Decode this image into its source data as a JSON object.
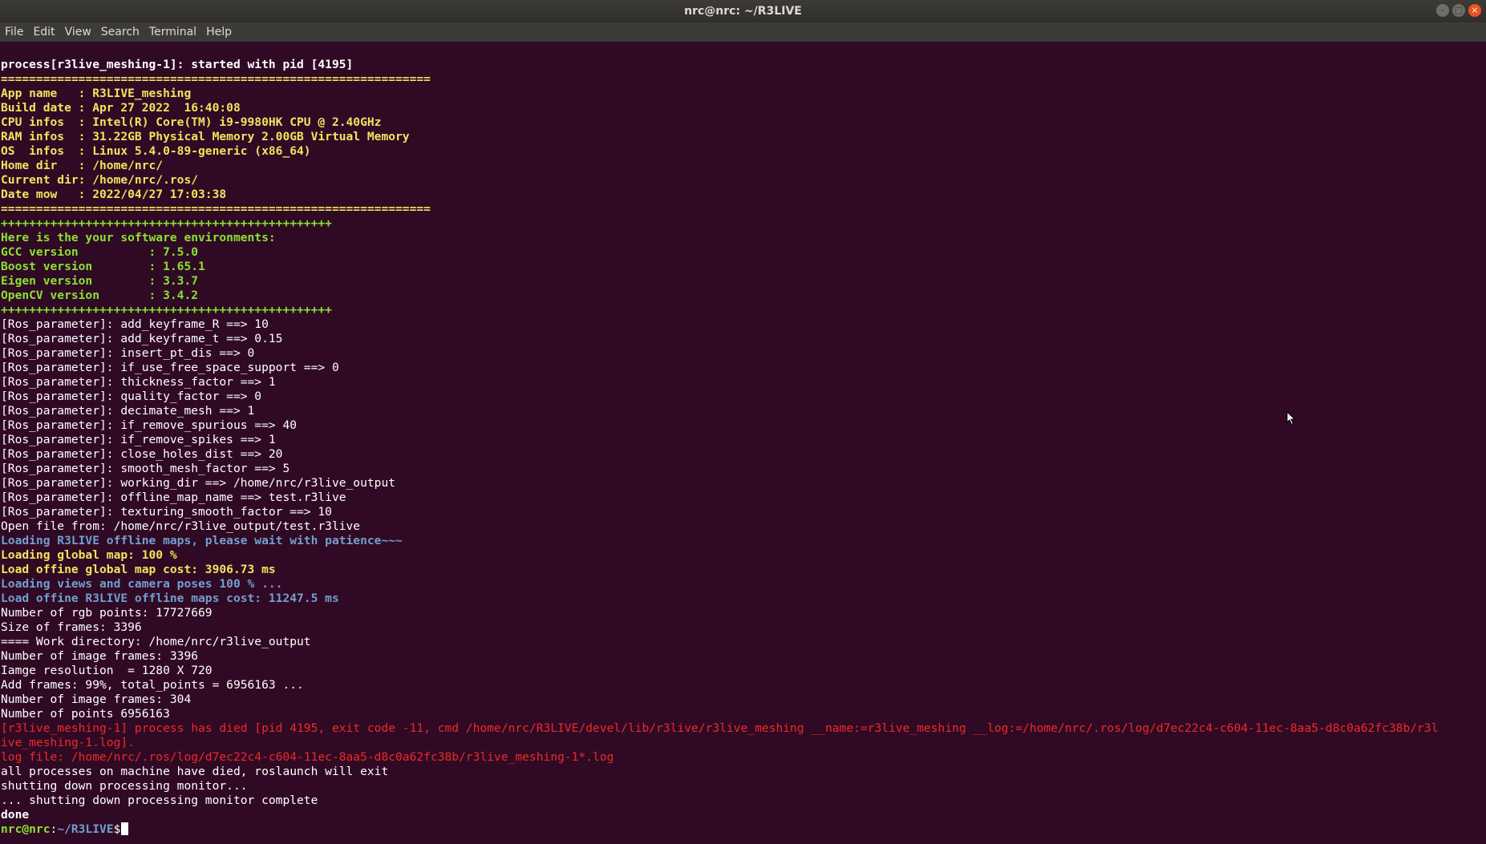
{
  "window": {
    "title": "nrc@nrc: ~/R3LIVE"
  },
  "menu": [
    "File",
    "Edit",
    "View",
    "Search",
    "Terminal",
    "Help"
  ],
  "terminal": {
    "lines": [
      {
        "cls": "bw",
        "text": "process[r3live_meshing-1]: started with pid [4195]"
      },
      {
        "cls": "y",
        "text": "============================================================="
      },
      {
        "cls": "y",
        "text": "App name   : R3LIVE_meshing"
      },
      {
        "cls": "y",
        "text": "Build date : Apr 27 2022  16:40:08"
      },
      {
        "cls": "y",
        "text": "CPU infos  : Intel(R) Core(TM) i9-9980HK CPU @ 2.40GHz"
      },
      {
        "cls": "y",
        "text": "RAM infos  : 31.22GB Physical Memory 2.00GB Virtual Memory"
      },
      {
        "cls": "y",
        "text": "OS  infos  : Linux 5.4.0-89-generic (x86_64)"
      },
      {
        "cls": "y",
        "text": "Home dir   : /home/nrc/"
      },
      {
        "cls": "y",
        "text": "Current dir: /home/nrc/.ros/"
      },
      {
        "cls": "y",
        "text": "Date mow   : 2022/04/27 17:03:38"
      },
      {
        "cls": "y",
        "text": "============================================================="
      },
      {
        "cls": "g",
        "text": "+++++++++++++++++++++++++++++++++++++++++++++++"
      },
      {
        "cls": "g",
        "text": "Here is the your software environments:"
      },
      {
        "cls": "g",
        "text": "GCC version          : 7.5.0"
      },
      {
        "cls": "g",
        "text": "Boost version        : 1.65.1"
      },
      {
        "cls": "g",
        "text": "Eigen version        : 3.3.7"
      },
      {
        "cls": "g",
        "text": "OpenCV version       : 3.4.2"
      },
      {
        "cls": "g",
        "text": "+++++++++++++++++++++++++++++++++++++++++++++++"
      },
      {
        "cls": "w",
        "text": "[Ros_parameter]: add_keyframe_R ==> 10"
      },
      {
        "cls": "w",
        "text": "[Ros_parameter]: add_keyframe_t ==> 0.15"
      },
      {
        "cls": "w",
        "text": "[Ros_parameter]: insert_pt_dis ==> 0"
      },
      {
        "cls": "w",
        "text": "[Ros_parameter]: if_use_free_space_support ==> 0"
      },
      {
        "cls": "w",
        "text": "[Ros_parameter]: thickness_factor ==> 1"
      },
      {
        "cls": "w",
        "text": "[Ros_parameter]: quality_factor ==> 0"
      },
      {
        "cls": "w",
        "text": "[Ros_parameter]: decimate_mesh ==> 1"
      },
      {
        "cls": "w",
        "text": "[Ros_parameter]: if_remove_spurious ==> 40"
      },
      {
        "cls": "w",
        "text": "[Ros_parameter]: if_remove_spikes ==> 1"
      },
      {
        "cls": "w",
        "text": "[Ros_parameter]: close_holes_dist ==> 20"
      },
      {
        "cls": "w",
        "text": "[Ros_parameter]: smooth_mesh_factor ==> 5"
      },
      {
        "cls": "w",
        "text": "[Ros_parameter]: working_dir ==> /home/nrc/r3live_output"
      },
      {
        "cls": "w",
        "text": "[Ros_parameter]: offline_map_name ==> test.r3live"
      },
      {
        "cls": "w",
        "text": "[Ros_parameter]: texturing_smooth_factor ==> 10"
      },
      {
        "cls": "w",
        "text": "Open file from: /home/nrc/r3live_output/test.r3live"
      },
      {
        "cls": "b",
        "text": "Loading R3LIVE offline maps, please wait with patience~~~"
      },
      {
        "cls": "y",
        "text": "Loading global map: 100 %"
      },
      {
        "cls": "y",
        "text": "Load offine global map cost: 3906.73 ms"
      },
      {
        "cls": "b",
        "text": "Loading views and camera poses 100 % ..."
      },
      {
        "cls": "b",
        "text": "Load offine R3LIVE offline maps cost: 11247.5 ms"
      },
      {
        "cls": "w",
        "text": "Number of rgb points: 17727669"
      },
      {
        "cls": "w",
        "text": "Size of frames: 3396"
      },
      {
        "cls": "w",
        "text": "==== Work directory: /home/nrc/r3live_output"
      },
      {
        "cls": "w",
        "text": "Number of image frames: 3396"
      },
      {
        "cls": "w",
        "text": "Iamge resolution  = 1280 X 720"
      },
      {
        "cls": "w",
        "text": "Add frames: 99%, total_points = 6956163 ..."
      },
      {
        "cls": "w",
        "text": "Number of image frames: 304"
      },
      {
        "cls": "w",
        "text": "Number of points 6956163"
      },
      {
        "cls": "r",
        "text": "[r3live_meshing-1] process has died [pid 4195, exit code -11, cmd /home/nrc/R3LIVE/devel/lib/r3live/r3live_meshing __name:=r3live_meshing __log:=/home/nrc/.ros/log/d7ec22c4-c604-11ec-8aa5-d8c0a62fc38b/r3l"
      },
      {
        "cls": "r",
        "text": "ive_meshing-1.log]."
      },
      {
        "cls": "r",
        "text": "log file: /home/nrc/.ros/log/d7ec22c4-c604-11ec-8aa5-d8c0a62fc38b/r3live_meshing-1*.log"
      },
      {
        "cls": "w",
        "text": "all processes on machine have died, roslaunch will exit"
      },
      {
        "cls": "w",
        "text": "shutting down processing monitor..."
      },
      {
        "cls": "w",
        "text": "... shutting down processing monitor complete"
      },
      {
        "cls": "bw",
        "text": "done"
      }
    ],
    "prompt": {
      "user": "nrc@nrc",
      "sep": ":",
      "path": "~/R3LIVE",
      "symbol": "$"
    }
  }
}
